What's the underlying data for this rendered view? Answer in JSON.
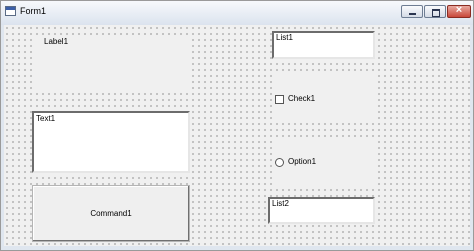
{
  "window": {
    "title": "Form1",
    "icon": "form-icon",
    "controls": {
      "minimize": "minimize-icon",
      "maximize": "maximize-icon",
      "close": "close-icon"
    }
  },
  "form": {
    "label1": "Label1",
    "text1": "Text1",
    "command1": "Command1",
    "list1": "List1",
    "check1": "Check1",
    "option1": "Option1",
    "list2": "List2"
  }
}
